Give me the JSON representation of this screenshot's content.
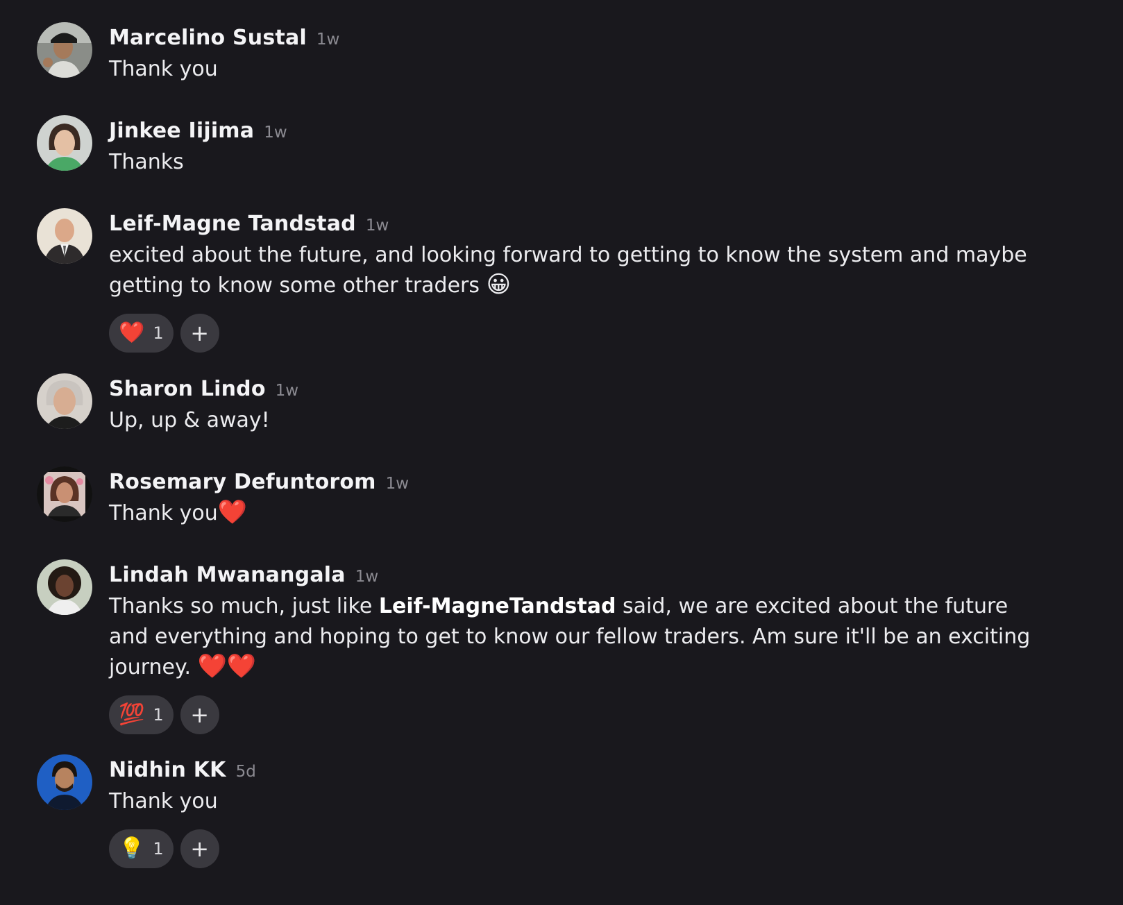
{
  "comments": [
    {
      "author": "Marcelino Sustal",
      "time": "1w",
      "text": "Thank you",
      "avatar_icon": "user-avatar-icon"
    },
    {
      "author": "Jinkee Iijima",
      "time": "1w",
      "text": "Thanks",
      "avatar_icon": "user-avatar-icon"
    },
    {
      "author": "Leif-Magne Tandstad",
      "time": "1w",
      "text": "excited about the future, and looking forward to getting to know the system and maybe getting to know some other traders",
      "text_emoji": "😀",
      "reactions": [
        {
          "emoji": "❤️",
          "count": "1"
        }
      ],
      "add_reaction_label": "+"
    },
    {
      "author": "Sharon Lindo",
      "time": "1w",
      "text": "Up, up & away!"
    },
    {
      "author": "Rosemary Defuntorom",
      "time": "1w",
      "text": "Thank you",
      "text_emoji": "❤️"
    },
    {
      "author": "Lindah Mwanangala",
      "time": "1w",
      "text_before": "Thanks so much, just like ",
      "mention": "Leif-MagneTandstad",
      "text_after": " said, we are excited about the future and everything and hoping to get to know our fellow traders. Am sure it'll be an exciting journey. ",
      "text_emoji": "❤️❤️",
      "reactions": [
        {
          "emoji": "💯",
          "count": "1"
        }
      ],
      "add_reaction_label": "+"
    },
    {
      "author": "Nidhin KK",
      "time": "5d",
      "text": "Thank you",
      "reactions": [
        {
          "emoji": "💡",
          "count": "1"
        }
      ],
      "add_reaction_label": "+"
    }
  ],
  "colors": {
    "background": "#19181d",
    "chip": "#3a393f",
    "timestamp": "#8c8b92"
  }
}
